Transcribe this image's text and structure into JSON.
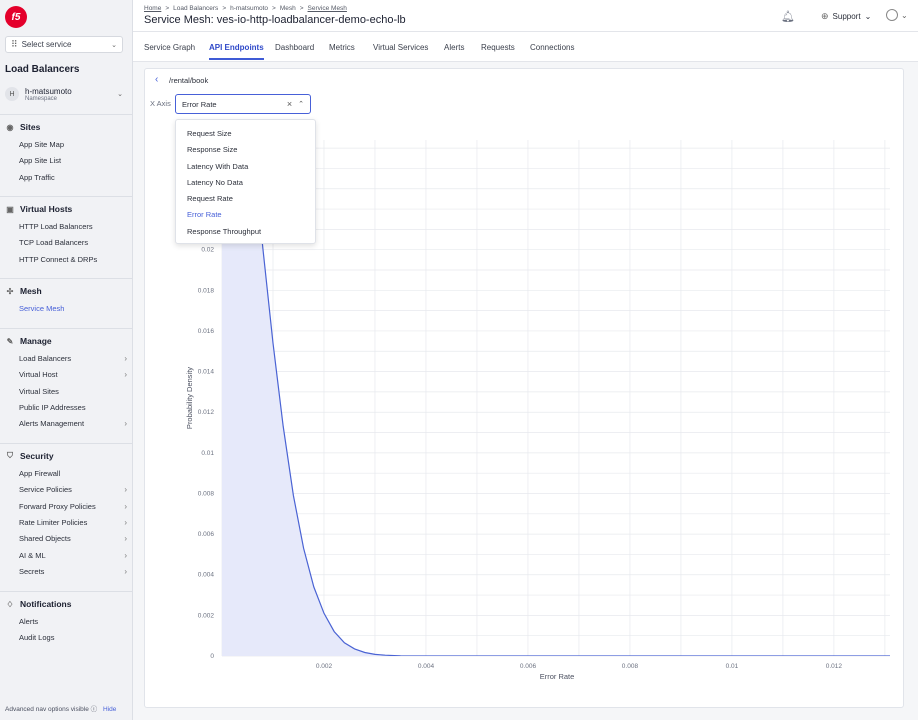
{
  "sidebar": {
    "logo": "f5",
    "select_service": "Select service",
    "app_title": "Load Balancers",
    "namespace": {
      "avatar": "H",
      "name": "h-matsumoto",
      "label": "Namespace"
    },
    "sections": [
      {
        "title": "Sites",
        "icon": "sites-icon",
        "items": [
          {
            "label": "App Site Map"
          },
          {
            "label": "App Site List"
          },
          {
            "label": "App Traffic"
          }
        ]
      },
      {
        "title": "Virtual Hosts",
        "icon": "virtual-hosts-icon",
        "items": [
          {
            "label": "HTTP Load Balancers"
          },
          {
            "label": "TCP Load Balancers"
          },
          {
            "label": "HTTP Connect & DRPs"
          }
        ]
      },
      {
        "title": "Mesh",
        "icon": "mesh-icon",
        "items": [
          {
            "label": "Service Mesh",
            "active": true
          }
        ]
      },
      {
        "title": "Manage",
        "icon": "manage-icon",
        "items": [
          {
            "label": "Load Balancers",
            "arrow": true
          },
          {
            "label": "Virtual Host",
            "arrow": true
          },
          {
            "label": "Virtual Sites"
          },
          {
            "label": "Public IP Addresses"
          },
          {
            "label": "Alerts Management",
            "arrow": true
          }
        ]
      },
      {
        "title": "Security",
        "icon": "shield-icon",
        "items": [
          {
            "label": "App Firewall"
          },
          {
            "label": "Service Policies",
            "arrow": true
          },
          {
            "label": "Forward Proxy Policies",
            "arrow": true
          },
          {
            "label": "Rate Limiter Policies",
            "arrow": true
          },
          {
            "label": "Shared Objects",
            "arrow": true
          },
          {
            "label": "AI & ML",
            "arrow": true
          },
          {
            "label": "Secrets",
            "arrow": true
          }
        ]
      },
      {
        "title": "Notifications",
        "icon": "bell-icon",
        "items": [
          {
            "label": "Alerts"
          },
          {
            "label": "Audit Logs"
          }
        ]
      }
    ],
    "footer": {
      "text": "Advanced nav options visible",
      "hide": "Hide"
    }
  },
  "header": {
    "breadcrumb": [
      "Home",
      "Load Balancers",
      "h-matsumoto",
      "Mesh",
      "Service Mesh"
    ],
    "title": "Service Mesh: ves-io-http-loadbalancer-demo-echo-lb",
    "support": "Support"
  },
  "tabs": [
    {
      "label": "Service Graph"
    },
    {
      "label": "API Endpoints",
      "active": true
    },
    {
      "label": "Dashboard"
    },
    {
      "label": "Metrics"
    },
    {
      "label": "Virtual Services"
    },
    {
      "label": "Alerts"
    },
    {
      "label": "Requests"
    },
    {
      "label": "Connections"
    }
  ],
  "content": {
    "path": "/rental/book",
    "xaxis_label": "X Axis",
    "xaxis_value": "Error Rate",
    "options": [
      "Request Size",
      "Response Size",
      "Latency With Data",
      "Latency No Data",
      "Request Rate",
      "Error Rate",
      "Response Throughput"
    ],
    "selected_option": "Error Rate"
  },
  "chart_data": {
    "type": "area",
    "xlabel": "Error Rate",
    "ylabel": "Probability Density",
    "xlim": [
      0,
      0.0131
    ],
    "ylim": [
      0,
      0.0254
    ],
    "x_ticks": [
      "0.002",
      "0.004",
      "0.006",
      "0.008",
      "0.01",
      "0.012"
    ],
    "y_ticks": [
      "0",
      "0.002",
      "0.004",
      "0.006",
      "0.008",
      "0.01",
      "0.012",
      "0.014",
      "0.016",
      "0.018",
      "0.02"
    ],
    "series": [
      {
        "x": [
          0,
          0.0002,
          0.0004,
          0.0006,
          0.0008,
          0.001,
          0.0012,
          0.0014,
          0.0016,
          0.0018,
          0.002,
          0.0022,
          0.0024,
          0.0026,
          0.0028,
          0.003,
          0.0032,
          0.0035,
          0.004,
          0.005,
          0.008,
          0.0131
        ],
        "y": [
          0.04,
          0.036,
          0.0309,
          0.0254,
          0.0201,
          0.0154,
          0.0113,
          0.0079,
          0.0053,
          0.0034,
          0.0021,
          0.0012,
          0.00065,
          0.00035,
          0.00017,
          8e-05,
          4e-05,
          1e-05,
          0,
          0,
          0,
          0
        ]
      }
    ],
    "colors": {
      "line": "#4a63d4",
      "fill": "#e6e9fa",
      "grid": "#e7e9ee"
    }
  }
}
